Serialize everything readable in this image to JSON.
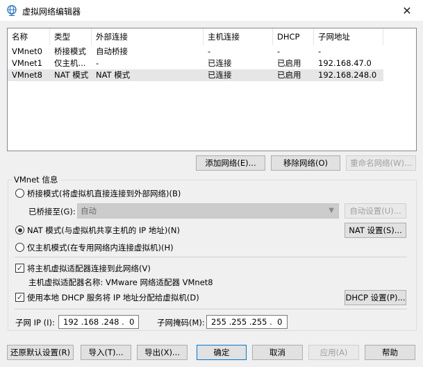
{
  "window": {
    "title": "虚拟网络编辑器"
  },
  "network_list": {
    "columns": [
      "名称",
      "类型",
      "外部连接",
      "主机连接",
      "DHCP",
      "子网地址"
    ],
    "rows": [
      {
        "name": "VMnet0",
        "type": "桥接模式",
        "external": "自动桥接",
        "host": "-",
        "dhcp": "-",
        "subnet": "-"
      },
      {
        "name": "VMnet1",
        "type": "仅主机...",
        "external": "-",
        "host": "已连接",
        "dhcp": "已启用",
        "subnet": "192.168.47.0"
      },
      {
        "name": "VMnet8",
        "type": "NAT 模式",
        "external": "NAT 模式",
        "host": "已连接",
        "dhcp": "已启用",
        "subnet": "192.168.248.0",
        "selected": true
      }
    ]
  },
  "list_buttons": {
    "add": "添加网络(E)...",
    "remove": "移除网络(O)",
    "rename": "重命名网络(W)..."
  },
  "vmnet_info": {
    "group_label": "VMnet 信息",
    "bridged_label": "桥接模式(将虚拟机直接连接到外部网络)(B)",
    "bridged_to_label": "已桥接至(G):",
    "bridged_to_value": "自动",
    "auto_settings": "自动设置(U)...",
    "nat_label": "NAT 模式(与虚拟机共享主机的 IP 地址)(N)",
    "nat_settings": "NAT 设置(S)...",
    "hostonly_label": "仅主机模式(在专用网络内连接虚拟机)(H)",
    "selected_mode": "nat",
    "connect_adapter_label": "将主机虚拟适配器连接到此网络(V)",
    "connect_adapter_checked": true,
    "adapter_name_text": "主机虚拟适配器名称: VMware 网络适配器 VMnet8",
    "dhcp_label": "使用本地 DHCP 服务将 IP 地址分配给虚拟机(D)",
    "dhcp_checked": true,
    "dhcp_settings": "DHCP 设置(P)...",
    "subnet_ip_label": "子网 IP (I):",
    "subnet_ip_value": "192 .168 .248 .  0",
    "subnet_mask_label": "子网掩码(M):",
    "subnet_mask_value": "255 .255 .255 .  0"
  },
  "footer_buttons": {
    "restore": "还原默认设置(R)",
    "import": "导入(T)...",
    "export": "导出(X)...",
    "ok": "确定",
    "cancel": "取消",
    "apply": "应用(A)",
    "help": "帮助"
  },
  "icons": {
    "title": "globe-network-icon",
    "close": "close-icon",
    "dropdown": "chevron-down-icon"
  }
}
